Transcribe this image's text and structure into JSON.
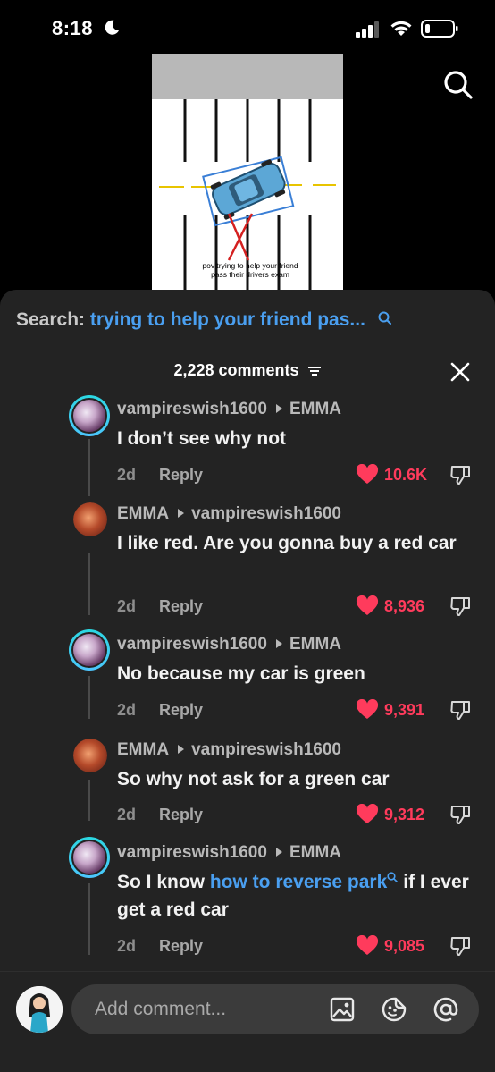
{
  "status_bar": {
    "time": "8:18"
  },
  "video": {
    "caption": "pov trying to help your friend pass their drivers exam"
  },
  "search": {
    "prefix": "Search:",
    "query": "trying to help your friend pas..."
  },
  "comments_header": {
    "count_label": "2,228 comments"
  },
  "comments": [
    {
      "author": "vampireswish1600",
      "reply_to": "EMMA",
      "text": "I don’t see why not",
      "age": "2d",
      "reply_label": "Reply",
      "likes": "10.6K",
      "avatar": "ring"
    },
    {
      "author": "EMMA",
      "reply_to": "vampireswish1600",
      "text": "I like red. Are you gonna buy a red car",
      "age": "2d",
      "reply_label": "Reply",
      "likes": "8,936",
      "avatar": "red"
    },
    {
      "author": "vampireswish1600",
      "reply_to": "EMMA",
      "text": "No because my car is green",
      "age": "2d",
      "reply_label": "Reply",
      "likes": "9,391",
      "avatar": "ring"
    },
    {
      "author": "EMMA",
      "reply_to": "vampireswish1600",
      "text": "So why not ask for a green car",
      "age": "2d",
      "reply_label": "Reply",
      "likes": "9,312",
      "avatar": "red"
    },
    {
      "author": "vampireswish1600",
      "reply_to": "EMMA",
      "text_before": "So I know ",
      "text_link": "how to reverse park",
      "text_after": "if I ever get a red car",
      "age": "2d",
      "reply_label": "Reply",
      "likes": "9,085",
      "avatar": "ring"
    }
  ],
  "composer": {
    "placeholder": "Add comment..."
  },
  "colors": {
    "sheet_bg": "#232323",
    "link_blue": "#4a9ff0",
    "like_red": "#ff3b5c"
  }
}
